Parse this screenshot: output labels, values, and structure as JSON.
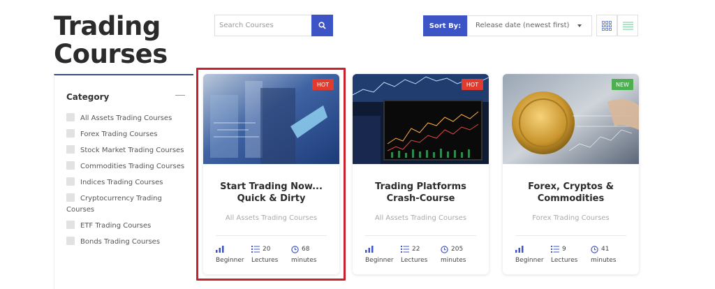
{
  "page": {
    "title": "Trading Courses"
  },
  "search": {
    "placeholder": "Search Courses"
  },
  "sort": {
    "label": "Sort By:",
    "selected": "Release date (newest first)"
  },
  "sidebar": {
    "title": "Category",
    "items": [
      "All Assets Trading Courses",
      "Forex Trading Courses",
      "Stock Market Trading Courses",
      "Commodities Trading Courses",
      "Indices Trading Courses",
      "Cryptocurrency Trading Courses",
      "ETF Trading Courses",
      "Bonds Trading Courses"
    ]
  },
  "courses": [
    {
      "badge": "HOT",
      "badge_color": "#e23a2c",
      "title": "Start Trading Now... Quick & Dirty",
      "category": "All Assets Trading Courses",
      "level": "Beginner",
      "lectures": "20",
      "lectures_label": "Lectures",
      "duration": "68",
      "duration_label": "minutes"
    },
    {
      "badge": "HOT",
      "badge_color": "#e23a2c",
      "title": "Trading Platforms Crash-Course",
      "category": "All Assets Trading Courses",
      "level": "Beginner",
      "lectures": "22",
      "lectures_label": "Lectures",
      "duration": "205",
      "duration_label": "minutes"
    },
    {
      "badge": "NEW",
      "badge_color": "#4caf50",
      "title": "Forex, Cryptos & Commodities",
      "category": "Forex Trading Courses",
      "level": "Beginner",
      "lectures": "9",
      "lectures_label": "Lectures",
      "duration": "41",
      "duration_label": "minutes"
    }
  ],
  "colors": {
    "accent": "#3d54c6",
    "highlight": "#c8232c"
  }
}
